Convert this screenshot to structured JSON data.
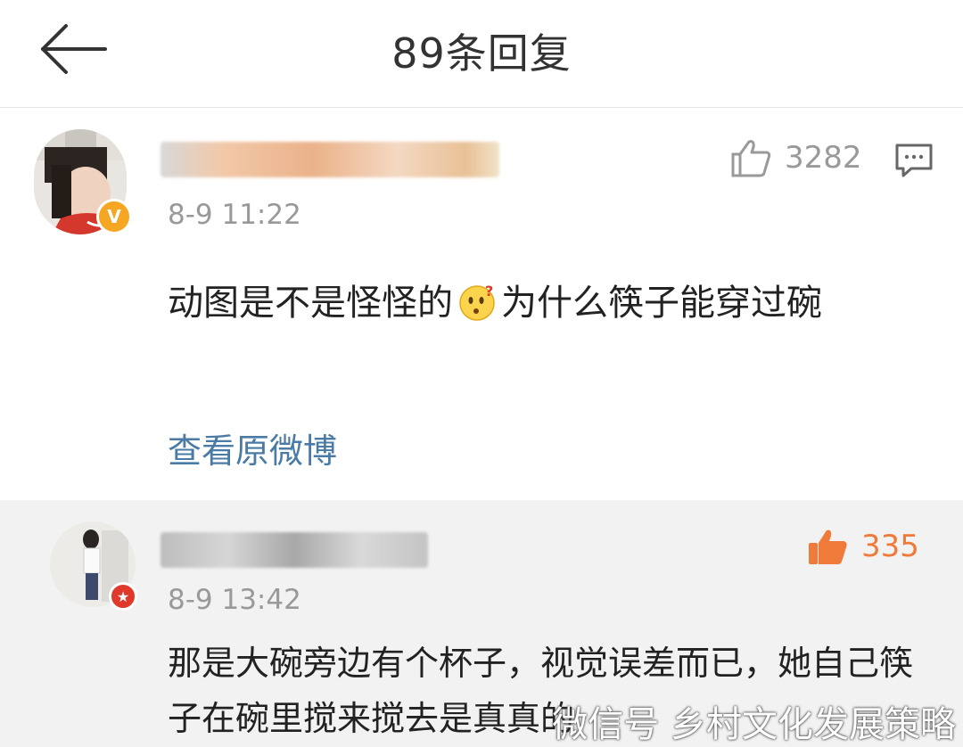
{
  "header": {
    "title": "89条回复"
  },
  "main_comment": {
    "time": "8-9 11:22",
    "like_count": "3282",
    "text_before_emoji": "动图是不是怪怪的",
    "emoji": "confused-face-emoji",
    "text_after_emoji": "为什么筷子能穿过碗",
    "view_original_label": "查看原微博",
    "badge_color": "#f5a623"
  },
  "reply": {
    "time": "8-9 13:42",
    "like_count": "335",
    "like_color": "#f07a3a",
    "text": "那是大碗旁边有个杯子，视觉误差而已，她自己筷子在碗里搅来搅去是真真的",
    "badge_color": "#e0392b"
  },
  "watermark": {
    "text": "微信号 乡村文化发展策略"
  }
}
